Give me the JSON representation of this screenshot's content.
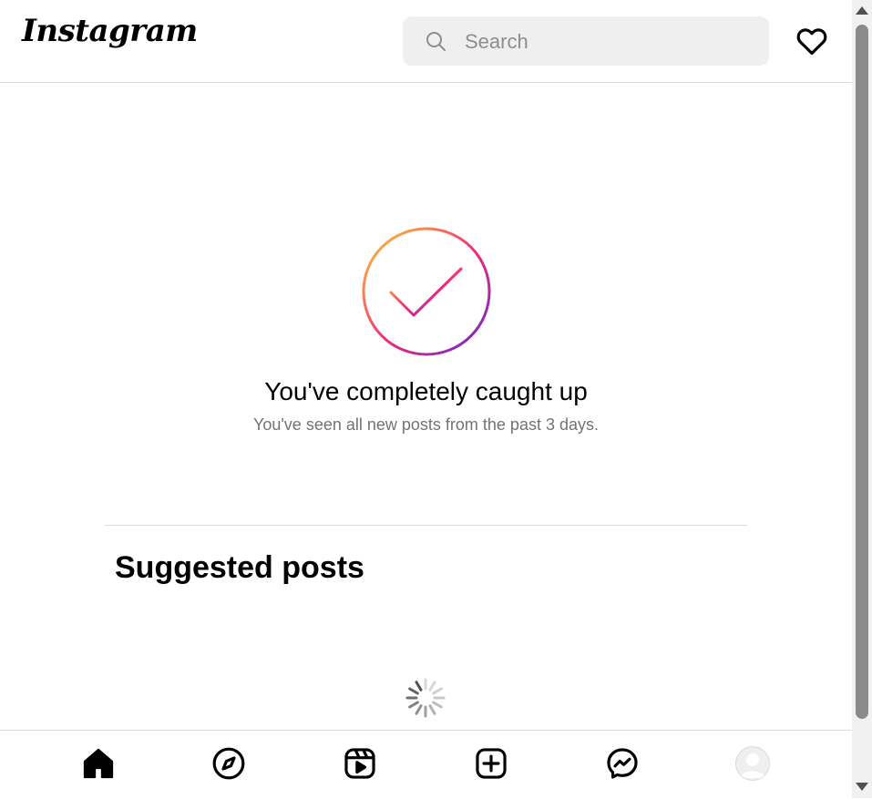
{
  "header": {
    "logo_text": "Instagram",
    "search": {
      "placeholder": "Search",
      "value": ""
    },
    "notifications_icon": "heart-icon"
  },
  "caught_up": {
    "icon": "checkmark-gradient-ring-icon",
    "title": "You've completely caught up",
    "subtitle": "You've seen all new posts from the past 3 days."
  },
  "suggested": {
    "heading": "Suggested posts",
    "loading": true
  },
  "bottom_nav": {
    "items": [
      {
        "name": "home",
        "icon": "home-icon",
        "active": true
      },
      {
        "name": "explore",
        "icon": "compass-icon"
      },
      {
        "name": "reels",
        "icon": "reels-icon"
      },
      {
        "name": "create",
        "icon": "plus-square-icon"
      },
      {
        "name": "messages",
        "icon": "messenger-icon"
      },
      {
        "name": "profile",
        "icon": "avatar"
      }
    ]
  },
  "colors": {
    "gradient": [
      "#f9ce34",
      "#ee2a7b",
      "#6228d7"
    ],
    "text_secondary": "#737373",
    "border": "#dbdbdb",
    "search_bg": "#efefef"
  }
}
